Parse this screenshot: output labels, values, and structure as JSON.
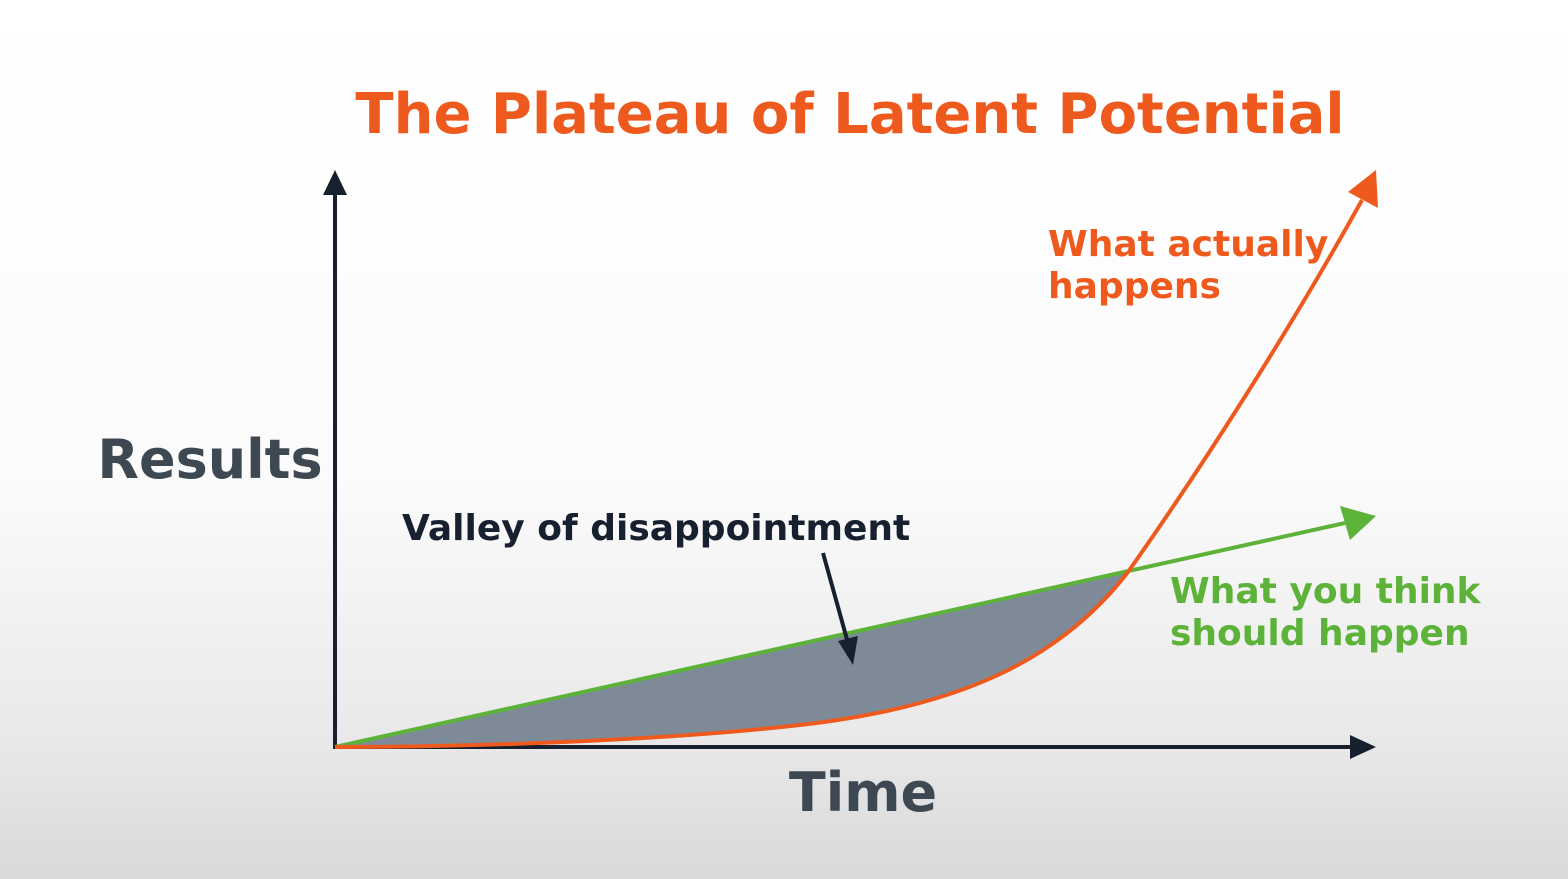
{
  "title": "The Plateau of Latent Potential",
  "axes": {
    "y_label": "Results",
    "x_label": "Time"
  },
  "annotations": {
    "valley": "Valley of disappointment",
    "actual_line1": "What actually",
    "actual_line2": "happens",
    "expected_line1": "What you think",
    "expected_line2": "should happen"
  },
  "colors": {
    "title": "#ee5a1e",
    "actual_curve": "#ee5a1e",
    "expected_line": "#5db33a",
    "axis": "#17202e",
    "valley_fill": "#7e8a98",
    "axis_label": "#3d4852"
  }
}
